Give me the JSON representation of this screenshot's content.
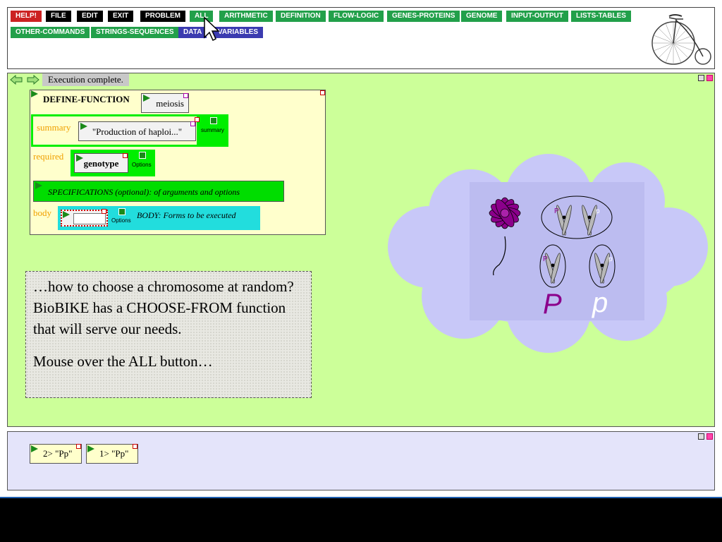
{
  "toolbar": {
    "buttons": [
      {
        "label": "HELP!",
        "color": "#cc2222"
      },
      {
        "label": "FILE",
        "color": "#000000"
      },
      {
        "label": "EDIT",
        "color": "#000000"
      },
      {
        "label": "EXIT",
        "color": "#000000"
      },
      {
        "label": "PROBLEM",
        "color": "#000000"
      },
      {
        "label": "ALL",
        "color": "#22a04a"
      },
      {
        "label": "ARITHMETIC",
        "color": "#22a04a"
      },
      {
        "label": "DEFINITION",
        "color": "#22a04a"
      },
      {
        "label": "FLOW-LOGIC",
        "color": "#22a04a"
      },
      {
        "label": "GENES-PROTEINS",
        "color": "#22a04a"
      },
      {
        "label": "GENOME",
        "color": "#22a04a"
      },
      {
        "label": "INPUT-OUTPUT",
        "color": "#22a04a"
      },
      {
        "label": "LISTS-TABLES",
        "color": "#22a04a"
      },
      {
        "label": "OTHER-COMMANDS",
        "color": "#22a04a"
      },
      {
        "label": "STRINGS-SEQUENCES",
        "color": "#22a04a"
      },
      {
        "label": "DATA",
        "color": "#3b3bb0"
      },
      {
        "label": "VARIABLES",
        "color": "#3b3bb0"
      }
    ],
    "logo_icon": "penny-farthing-bicycle-icon"
  },
  "workspace": {
    "status": "Execution complete.",
    "nav_back_icon": "arrow-left-icon",
    "nav_forward_icon": "arrow-right-icon",
    "define_function": {
      "keyword": "DEFINE-FUNCTION",
      "name": "meiosis",
      "summary_tag": "summary",
      "summary_value": "\"Production of haploi...\"",
      "summary_option": "summary",
      "required_tag": "required",
      "required_value": "genotype",
      "required_option": "Options",
      "specifications": "SPECIFICATIONS (optional): of arguments and options",
      "body_tag": "body",
      "body_option": "Options",
      "body_hint": "BODY: Forms to be executed"
    },
    "note": {
      "paragraph1": "…how to choose a chromosome at random? BioBIKE has a CHOOSE-FROM function that will serve our needs.",
      "paragraph2": "Mouse over the ALL button…"
    },
    "cloud": {
      "flower_icon": "purple-flower-icon",
      "chromosome_labels": [
        "P",
        "p",
        "P",
        "p"
      ],
      "allele_big_left": "P",
      "allele_big_right": "p"
    }
  },
  "results": [
    {
      "label": "2> \"Pp\""
    },
    {
      "label": "1> \"Pp\""
    }
  ],
  "colors": {
    "workspace_bg": "#ccff99",
    "results_bg": "#e4e4fa",
    "cloud_bg": "#c8c8f8",
    "flower": "#8b008b"
  }
}
